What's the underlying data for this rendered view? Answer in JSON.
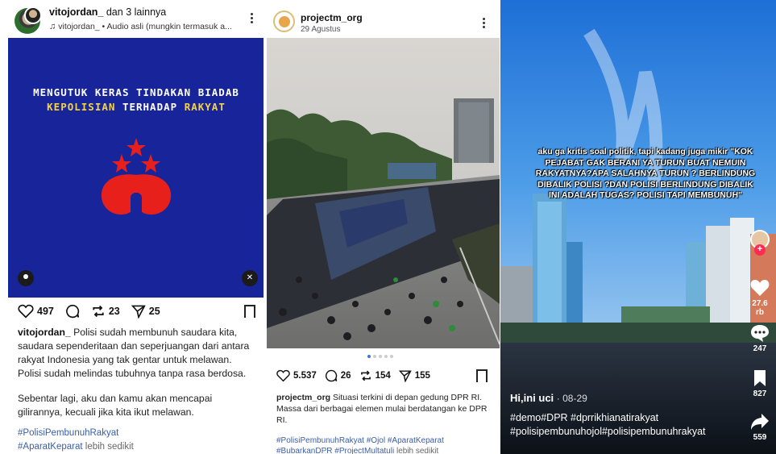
{
  "panel1": {
    "username": "vitojordan_",
    "user_suffix": "dan 3 lainnya",
    "audio": "vitojordan_ • Audio asli (mungkin termasuk a...",
    "banner_line1": "MENGUTUK KERAS TINDAKAN BIADAB",
    "banner_line2a": "KEPOLISIAN",
    "banner_line2b": "TERHADAP",
    "banner_line2c": "RAKYAT",
    "likes": "497",
    "reposts": "23",
    "shares": "25",
    "caption_user": "vitojordan_",
    "caption_text": "Polisi sudah membunuh saudara kita, saudara sependeritaan dan seperjuangan dari antara rakyat Indonesia yang tak gentar untuk melawan. Polisi sudah melindas tubuhnya tanpa rasa berdosa.",
    "caption_text2": "Sebentar lagi, aku dan kamu akan mencapai gilirannya, kecuali jika kita ikut melawan.",
    "tag1": "#PolisiPembunuhRakyat",
    "tag2": "#AparatKeparat",
    "more": "lebih sedikit"
  },
  "panel2": {
    "username": "projectm_org",
    "date": "29 Agustus",
    "likes": "5.537",
    "comments": "26",
    "reposts": "154",
    "shares": "155",
    "caption_user": "projectm_org",
    "caption_text": "Situasi terkini di depan gedung DPR RI. Massa dari berbagai elemen mulai berdatangan ke DPR RI.",
    "tags_line1": "#PolisiPembunuhRakyat #Ojol #AparatKeparat",
    "tags_line2": "#BubarkanDPR #ProjectMultatuli",
    "more": "lebih sedikit"
  },
  "panel3": {
    "overlay_text": "aku ga kritis soal politik, tapi kadang juga mikir \"KOK PEJABAT GAK BERANI YA TURUN BUAT NEMUIN RAKYATNYA?APA SALAHNYA TURUN ? BERLINDUNG DIBALIK POLISI ?DAN POLISI BERLINDUNG DIBALIK INI ADALAH TUGAS? POLISI TAPI MEMBUNUH\"",
    "handle": "Hi,ini uci",
    "date": "· 08-29",
    "description": "#demo#DPR #dprrikhianatirakyat #polisipembunuhojol#polisipembunuhrakyat",
    "likes": "27.6 rb",
    "comments": "247",
    "saves": "827",
    "shares": "559"
  },
  "colors": {
    "banner_bg": "#18249a",
    "emblem_red": "#e8201c",
    "banner_yellow": "#f2d34a",
    "link_blue": "#3a5ea8",
    "tiktok_red": "#fe2c55"
  }
}
